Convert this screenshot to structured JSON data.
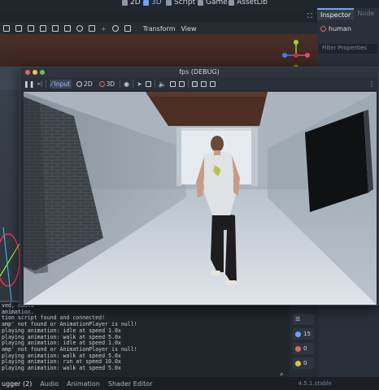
{
  "editor": {
    "modes": [
      {
        "label": "2D",
        "icon": "view-2d-icon"
      },
      {
        "label": "3D",
        "icon": "view-3d-icon"
      },
      {
        "label": "Script",
        "icon": "script-icon"
      },
      {
        "label": "Game",
        "icon": "game-icon"
      },
      {
        "label": "AssetLib",
        "icon": "assetlib-icon"
      }
    ],
    "toolbar": {
      "transform_label": "Transform",
      "view_label": "View"
    }
  },
  "inspector": {
    "tab_inspector": "Inspector",
    "tab_node": "Node",
    "node_name": "human",
    "filter_placeholder": "Filter Properties"
  },
  "game_window": {
    "title": "fps (DEBUG)",
    "toolbar": {
      "input_label": "Input",
      "view2d_label": "2D",
      "view3d_label": "3D"
    }
  },
  "console": {
    "lines": [
      "ved, could",
      "animation.",
      "tion script found and connected!",
      "amp' not found or AnimationPlayer is null!",
      "  playing animation: idle at speed 1.0x",
      "  playing animation: walk at speed 5.0x",
      "  playing animation: idle at speed 1.0x",
      "amp' not found or AnimationPlayer is null!",
      "  playing animation: walk at speed 5.0x",
      "  playing animation: run at speed 10.0x",
      "  playing animation: walk at speed 5.0x"
    ],
    "warning_count": "15",
    "error_count": "0",
    "info_count": "0"
  },
  "bottom_tabs": [
    "ugger (2)",
    "Audio",
    "Animation",
    "Shader Editor"
  ],
  "version_text": "4.5.1.stable",
  "colors": {
    "accent": "#6da3f5",
    "error": "#e46363",
    "warning": "#e8c040"
  }
}
